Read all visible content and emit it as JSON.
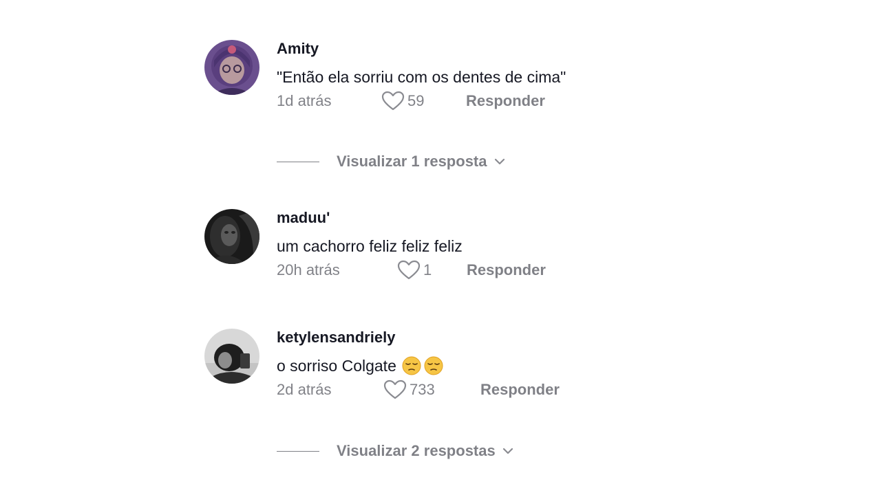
{
  "comments": [
    {
      "username": "Amity",
      "text": "\"Então ela sorriu com os dentes de cima\"",
      "time": "1d atrás",
      "likes": "59",
      "reply_label": "Responder",
      "avatar_icon": "anime-girl-avatar",
      "view_replies": "Visualizar 1 resposta"
    },
    {
      "username": "maduu'",
      "text": "um cachorro feliz feliz feliz",
      "time": "20h atrás",
      "likes": "1",
      "reply_label": "Responder",
      "avatar_icon": "dark-photo-avatar"
    },
    {
      "username": "ketylensandriely",
      "text": "o sorriso Colgate",
      "emojis": [
        "pensive-face-emoji",
        "pensive-face-emoji"
      ],
      "time": "2d atrás",
      "likes": "733",
      "reply_label": "Responder",
      "avatar_icon": "grayscale-photo-avatar",
      "view_replies": "Visualizar 2 respostas"
    }
  ],
  "colors": {
    "text_primary": "#161823",
    "text_secondary": "#8a8b91"
  },
  "icons": {
    "like": "heart-outline-icon",
    "expand": "chevron-down-icon"
  }
}
